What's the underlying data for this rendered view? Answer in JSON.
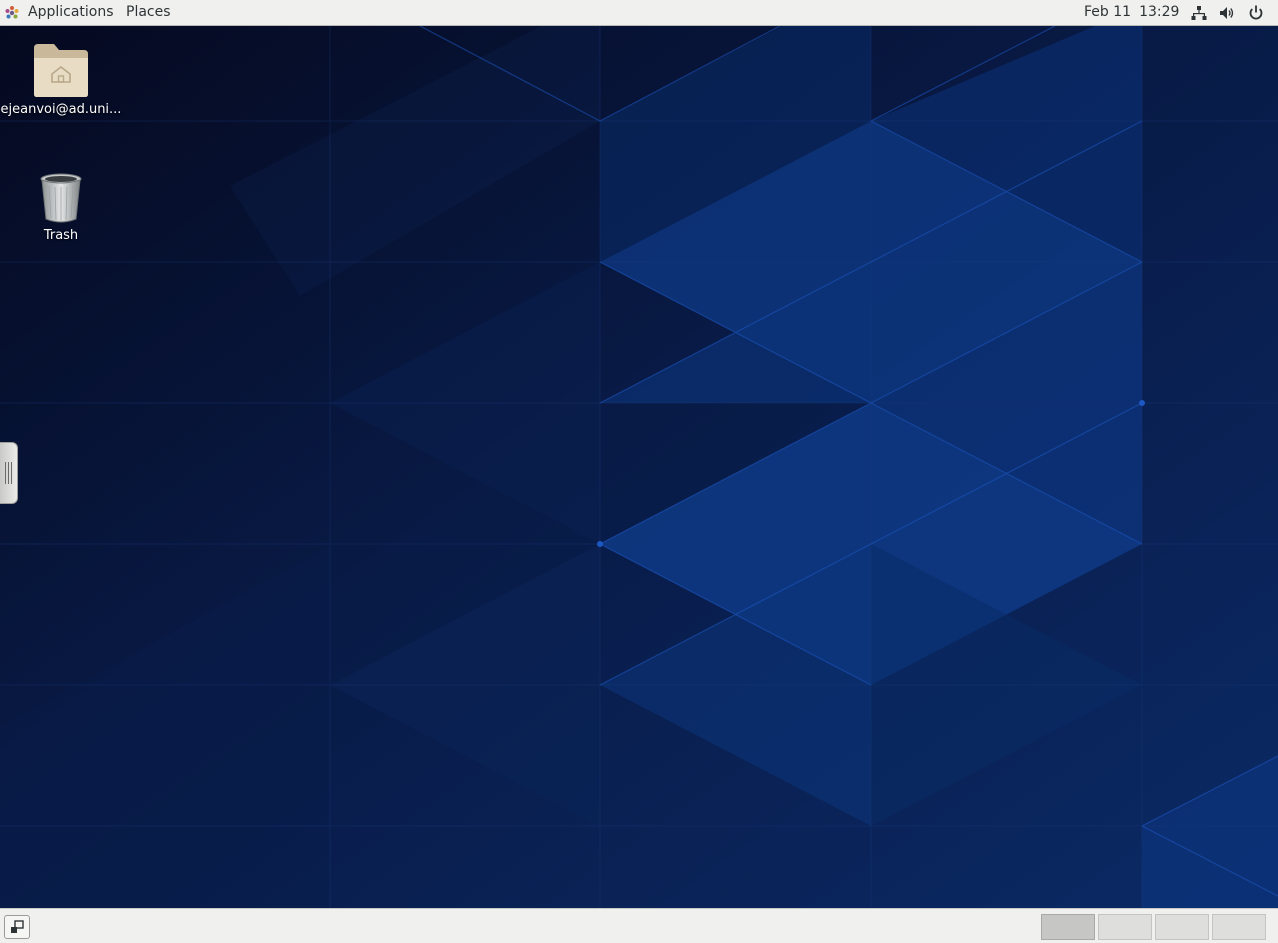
{
  "top_panel": {
    "applications_label": "Applications",
    "places_label": "Places",
    "date": "Feb 11",
    "time": "13:29",
    "icons": [
      "network-icon",
      "volume-icon",
      "power-icon"
    ]
  },
  "desktop": {
    "icons": [
      {
        "name": "home-folder",
        "icon": "home-folder-icon",
        "label": "ejeanvoi@ad.uni..."
      },
      {
        "name": "trash",
        "icon": "trash-icon",
        "label": "Trash"
      }
    ]
  },
  "bottom_panel": {
    "show_desktop_icon": "show-desktop-icon",
    "workspaces": [
      "workspace-1",
      "workspace-2",
      "workspace-3",
      "workspace-4"
    ],
    "active_workspace": 1
  },
  "colors": {
    "panel_bg": "#f0f0ef",
    "wallpaper_dark": "#060d2a",
    "wallpaper_blue": "#0f3d8a",
    "text": "#2e3436"
  }
}
